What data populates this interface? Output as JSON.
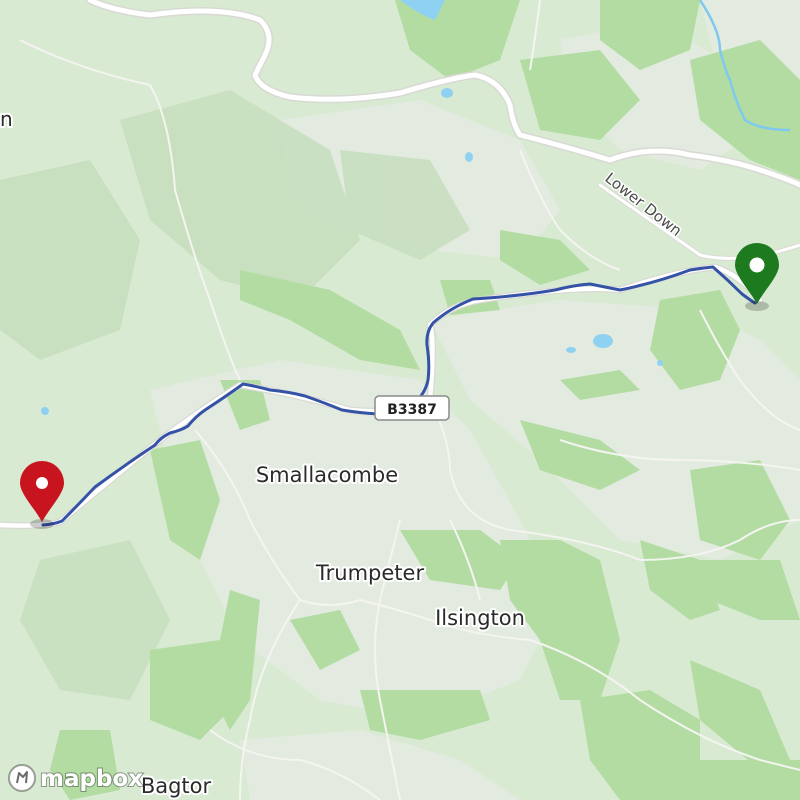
{
  "map": {
    "provider_logo": "mapbox",
    "colors": {
      "base_land": "#d8ead2",
      "woodland": "#b4dea5",
      "hills": "#c6e1bd",
      "fields": "#e2eadf",
      "water": "#8ed0f0",
      "route": "#3553a6",
      "start_pin": "#1e7a1e",
      "end_pin": "#c8141e"
    },
    "places": [
      {
        "name": "Smallacombe"
      },
      {
        "name": "Trumpeter"
      },
      {
        "name": "Ilsington"
      },
      {
        "name": "Bagtor"
      },
      {
        "name": "n"
      }
    ],
    "roads": {
      "lower_down": "Lower Down",
      "b3387": "B3387"
    },
    "markers": {
      "start": {
        "icon": "map-pin-green-icon",
        "color": "#1e7a1e"
      },
      "end": {
        "icon": "map-pin-red-icon",
        "color": "#c8141e"
      }
    }
  }
}
